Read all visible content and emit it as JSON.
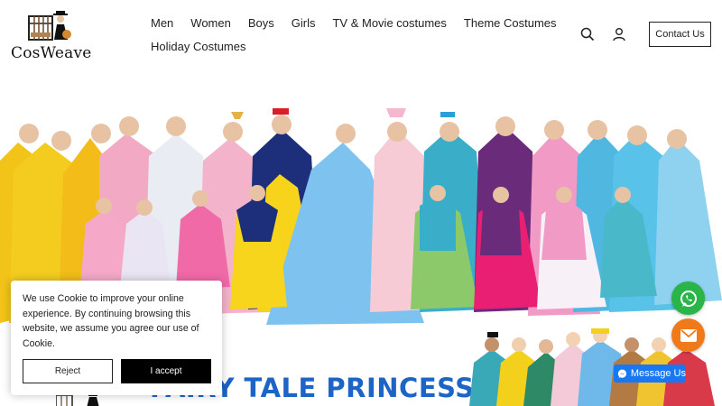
{
  "brand": {
    "name": "CosWeave"
  },
  "nav": {
    "row1": [
      "Men",
      "Women",
      "Boys",
      "Girls",
      "TV & Movie costumes",
      "Theme Costumes"
    ],
    "row2": [
      "Holiday Costumes"
    ]
  },
  "header_actions": {
    "contact_label": "Contact Us"
  },
  "section": {
    "title": "FAIRY TALE PRINCESS"
  },
  "cookie": {
    "text": "We use Cookie to improve your online experience. By continuing browsing this website, we assume you agree our use of Cookie.",
    "reject_label": "Reject",
    "accept_label": "I accept"
  },
  "floating": {
    "messenger_label": "Message Us"
  },
  "colors": {
    "accent_blue": "#1c64c6",
    "whatsapp": "#29b548",
    "mail": "#f07a1a",
    "messenger": "#1877f2"
  }
}
